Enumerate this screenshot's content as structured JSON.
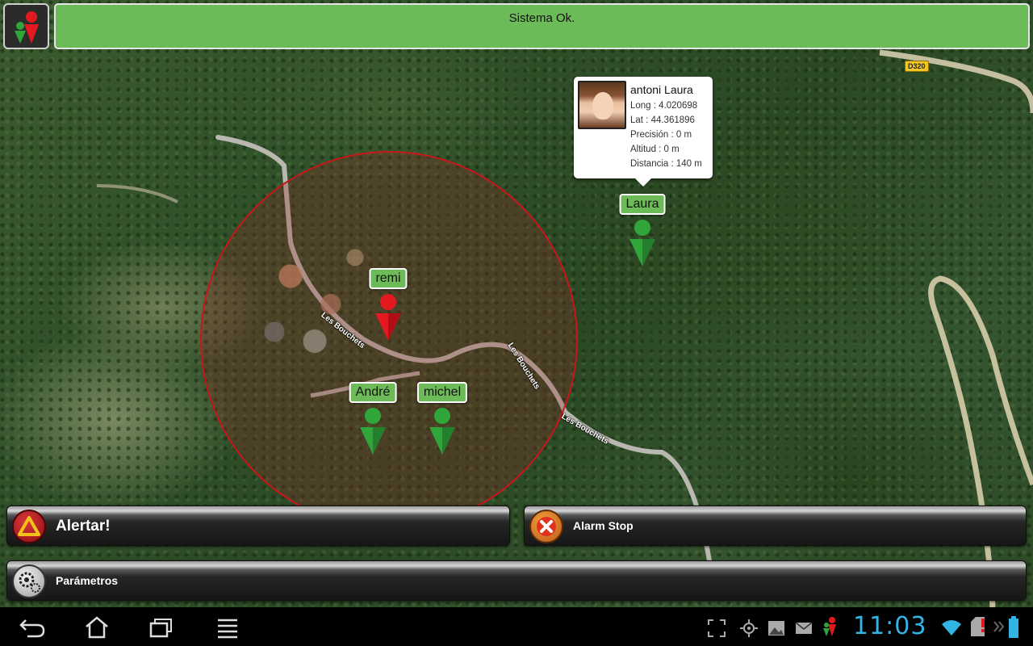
{
  "status": {
    "message": "Sistema Ok."
  },
  "map": {
    "road_labels": [
      "Les Bouchets",
      "Les Bouchets",
      "Les Bouchets"
    ],
    "road_number": "D320",
    "zone_color": "#c8161b"
  },
  "markers": [
    {
      "name": "Laura",
      "color": "green"
    },
    {
      "name": "remi",
      "color": "red"
    },
    {
      "name": "André",
      "color": "green"
    },
    {
      "name": "michel",
      "color": "green"
    }
  ],
  "popup": {
    "name": "antoni Laura",
    "long": "Long : 4.020698",
    "lat": "Lat : 44.361896",
    "precision": "Precisión : 0 m",
    "altitude": "Altitud : 0 m",
    "distance": "Distancia : 140 m"
  },
  "actions": {
    "alert_label": "Alertar!",
    "alarm_stop_label": "Alarm Stop",
    "settings_label": "Parámetros"
  },
  "system_bar": {
    "time": "11:03",
    "nav_icons": [
      "back-icon",
      "home-icon",
      "recent-apps-icon",
      "menu-icon"
    ],
    "notification_icons": [
      "fullscreen-icon",
      "gps-icon",
      "gallery-icon",
      "mail-icon",
      "app-notification-icon"
    ],
    "status_icons": [
      "wifi-icon",
      "sd-card-alert-icon",
      "battery-icon"
    ]
  },
  "colors": {
    "accent_green": "#6bbb59",
    "alert_red": "#c8161b",
    "clock_blue": "#32b5e5"
  }
}
